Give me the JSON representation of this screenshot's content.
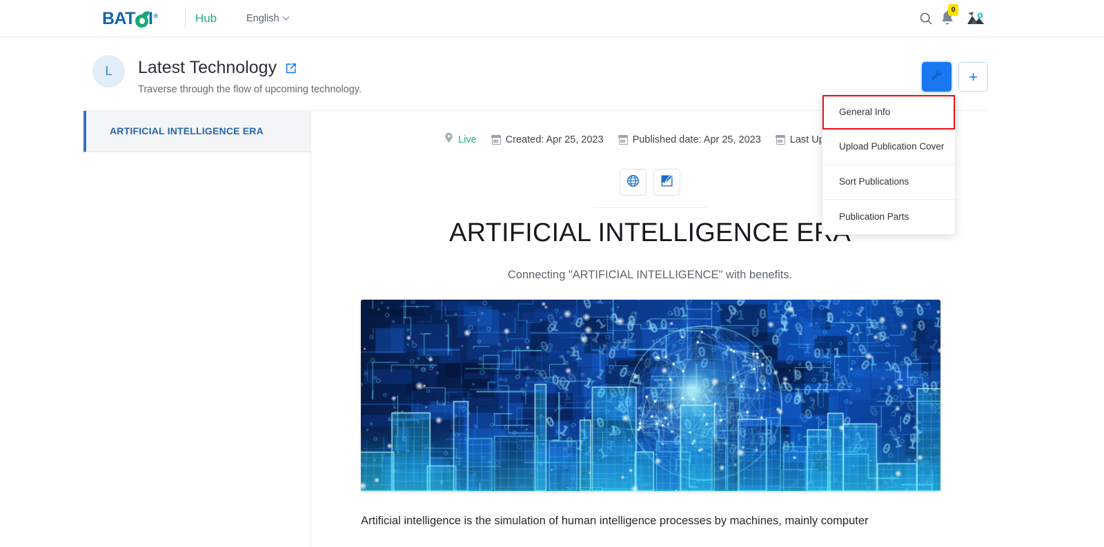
{
  "topnav": {
    "brand": {
      "part1": "BAT",
      "part2": "I",
      "reg": "®",
      "name": "BATOI"
    },
    "links": [
      {
        "label": "Hub",
        "name": "nav-link-hub"
      }
    ],
    "language": {
      "label": "English"
    },
    "icons": {
      "search": "search-icon",
      "bell": "bell-icon",
      "avatar": "user-avatar"
    },
    "notification_count": "0"
  },
  "page_header": {
    "avatar_initial": "L",
    "title": "Latest Technology",
    "subtitle": "Traverse through the flow of upcoming technology.",
    "external_link_icon": "external-link-icon",
    "actions": {
      "tool_label": "",
      "tool_icon": "wrench-icon",
      "add_label": "+"
    }
  },
  "sidebar": {
    "items": [
      {
        "label": "ARTIFICIAL INTELLIGENCE ERA",
        "active": true
      }
    ]
  },
  "main": {
    "meta": [
      {
        "icon": "location-pin-icon",
        "label": "Live",
        "accent": true
      },
      {
        "icon": "calendar-icon",
        "label": "Created: Apr 25, 2023"
      },
      {
        "icon": "calendar-icon",
        "label": "Published date: Apr 25, 2023"
      },
      {
        "icon": "calendar-icon",
        "label": "Last Update: A"
      }
    ],
    "circle_actions": [
      {
        "icon": "globe-icon",
        "name": "preview-globe-button"
      },
      {
        "icon": "edit-square-icon",
        "name": "edit-button"
      }
    ],
    "doc_title": "ARTIFICIAL INTELLIGENCE ERA",
    "doc_subtitle": "Connecting \"ARTIFICIAL INTELLIGENCE\" with benefits.",
    "hero_alt": "artificial-intelligence-circuit-city-cover",
    "body_paragraph": "Artificial intelligence is the simulation of human intelligence processes by machines, mainly computer"
  },
  "dropdown": {
    "items": [
      {
        "label": "General Info",
        "highlighted": true
      },
      {
        "label": "Upload Publication Cover",
        "highlighted": false
      },
      {
        "label": "Sort Publications",
        "highlighted": false
      },
      {
        "label": "Publication Parts",
        "highlighted": false
      }
    ]
  },
  "colors": {
    "brand_blue": "#1464ad",
    "brand_green": "#18a87a",
    "accent_blue": "#1a78f2",
    "live_green": "#22b07d",
    "highlight_red": "#f40d0d",
    "badge_yellow": "#ffe000"
  }
}
